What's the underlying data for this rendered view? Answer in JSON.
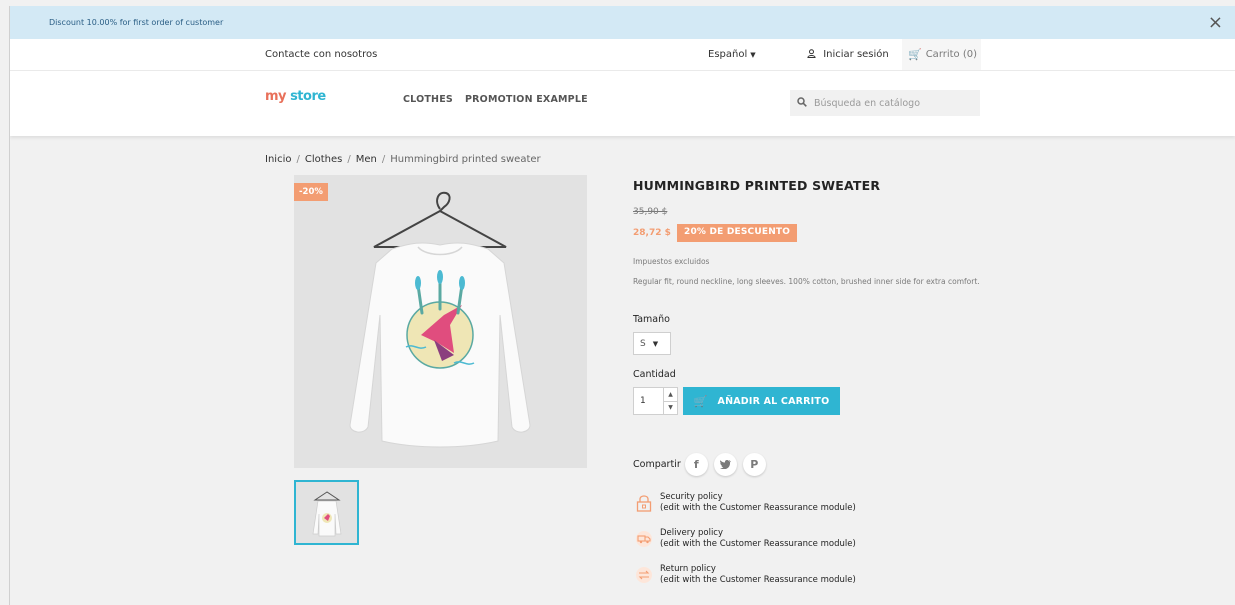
{
  "promo": {
    "text": "Discount 10.00% for first order of customer",
    "close_icon": "×"
  },
  "topnav": {
    "contact": "Contacte con nosotros",
    "language": "Español",
    "signin": "Iniciar sesión",
    "cart": "Carrito (0)"
  },
  "header": {
    "logo_my": "my",
    "logo_store": "store",
    "nav": [
      "CLOTHES",
      "PROMOTION EXAMPLE"
    ],
    "search_placeholder": "Búsqueda en catálogo"
  },
  "breadcrumb": [
    "Inicio",
    "Clothes",
    "Men",
    "Hummingbird printed sweater"
  ],
  "product": {
    "discount_flag": "-20%",
    "title": "HUMMINGBIRD PRINTED SWEATER",
    "old_price": "35,90 $",
    "new_price": "28,72 $",
    "discount_badge": "20% DE DESCUENTO",
    "tax": "Impuestos excluidos",
    "description": "Regular fit, round neckline, long sleeves. 100% cotton, brushed inner side for extra comfort.",
    "size_label": "Tamaño",
    "size_value": "S",
    "quantity_label": "Cantidad",
    "quantity_value": "1",
    "add_to_cart": "AÑADIR AL CARRITO",
    "share_label": "Compartir",
    "share_icons": [
      "facebook-icon",
      "twitter-icon",
      "pinterest-icon"
    ]
  },
  "reassurance": [
    {
      "title": "Security policy",
      "subtitle": "(edit with the Customer Reassurance module)",
      "icon": "lock-icon"
    },
    {
      "title": "Delivery policy",
      "subtitle": "(edit with the Customer Reassurance module)",
      "icon": "truck-icon"
    },
    {
      "title": "Return policy",
      "subtitle": "(edit with the Customer Reassurance module)",
      "icon": "return-icon"
    }
  ],
  "colors": {
    "accent": "#2fb5d2",
    "sale": "#f39d72",
    "promo_bar": "#d3e9f5"
  }
}
